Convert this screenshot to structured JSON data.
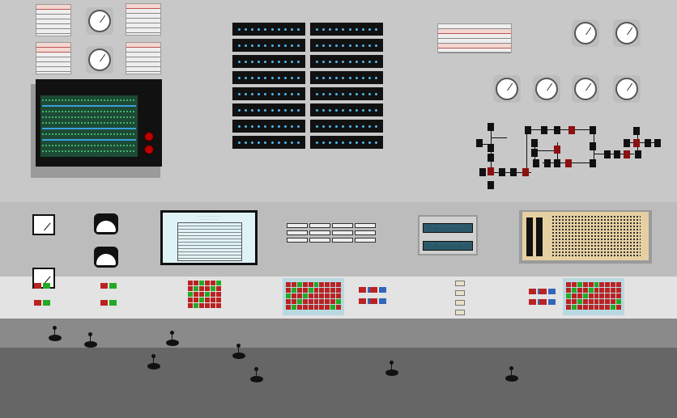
{
  "scene": "control_room_console",
  "colors": {
    "wall": "#c8c8c8",
    "rack_led": "#4fb6ee",
    "indicator_red": "#b22222",
    "indicator_green": "#22aa22",
    "lcd_background": "#2c5969",
    "board": "#e6d0a2"
  },
  "icons": {
    "upper_dials": "rotary-dial-icon",
    "gauges": "analog-gauge-icon",
    "knobs": "control-knob-icon",
    "circuit": "circuit-diagram-icon"
  },
  "lcd": {
    "line1": "·· ··· ··· ··· ·· ···",
    "line2": "··· ··· ··· ··· ··· ···"
  }
}
